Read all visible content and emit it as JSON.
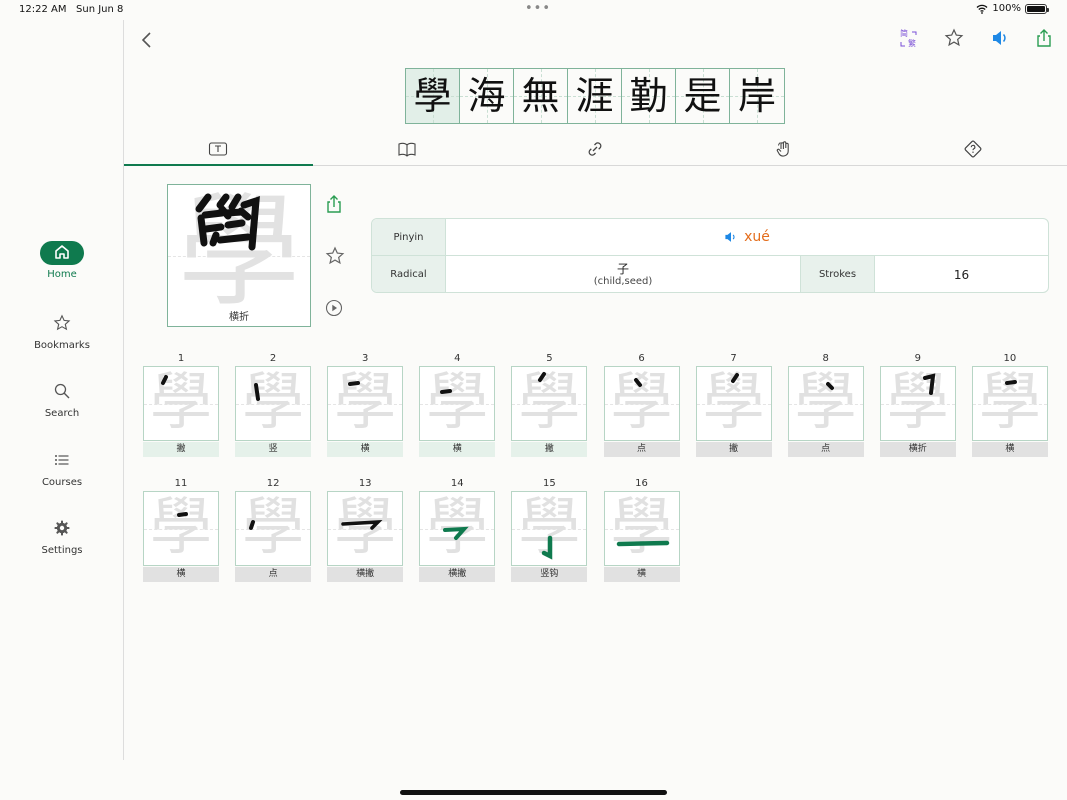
{
  "status": {
    "time": "12:22 AM",
    "date": "Sun Jun 8",
    "battery": "100%"
  },
  "sidebar": {
    "items": [
      {
        "label": "Home",
        "icon": "home-icon",
        "active": true
      },
      {
        "label": "Bookmarks",
        "icon": "star-icon",
        "active": false
      },
      {
        "label": "Search",
        "icon": "search-icon",
        "active": false
      },
      {
        "label": "Courses",
        "icon": "list-icon",
        "active": false
      },
      {
        "label": "Settings",
        "icon": "gear-icon",
        "active": false
      }
    ]
  },
  "toolbar": {
    "simp_trad_top": "简",
    "simp_trad_bottom": "繁"
  },
  "phrase": [
    "學",
    "海",
    "無",
    "涯",
    "勤",
    "是",
    "岸"
  ],
  "selected_char": "學",
  "tabs": [
    "text-tab-icon",
    "book-tab-icon",
    "link-tab-icon",
    "hand-tab-icon",
    "quiz-tab-icon"
  ],
  "current_stroke_label": "横折",
  "info": {
    "pinyin_label": "Pinyin",
    "pinyin": "xué",
    "radical_label": "Radical",
    "radical": "子",
    "radical_meaning": "(child,seed)",
    "strokes_label": "Strokes",
    "strokes": "16"
  },
  "strokes": [
    {
      "num": "1",
      "name": "撇"
    },
    {
      "num": "2",
      "name": "竖"
    },
    {
      "num": "3",
      "name": "横"
    },
    {
      "num": "4",
      "name": "横"
    },
    {
      "num": "5",
      "name": "撇"
    },
    {
      "num": "6",
      "name": "点"
    },
    {
      "num": "7",
      "name": "撇"
    },
    {
      "num": "8",
      "name": "点"
    },
    {
      "num": "9",
      "name": "横折"
    },
    {
      "num": "10",
      "name": "横"
    },
    {
      "num": "11",
      "name": "横"
    },
    {
      "num": "12",
      "name": "点"
    },
    {
      "num": "13",
      "name": "横撇"
    },
    {
      "num": "14",
      "name": "横撇"
    },
    {
      "num": "15",
      "name": "竖钩"
    },
    {
      "num": "16",
      "name": "横"
    }
  ],
  "colors": {
    "accent": "#0f7a4e",
    "pinyin": "#e46d1c",
    "speaker": "#1e88e5",
    "purple": "#7a4fd6"
  }
}
